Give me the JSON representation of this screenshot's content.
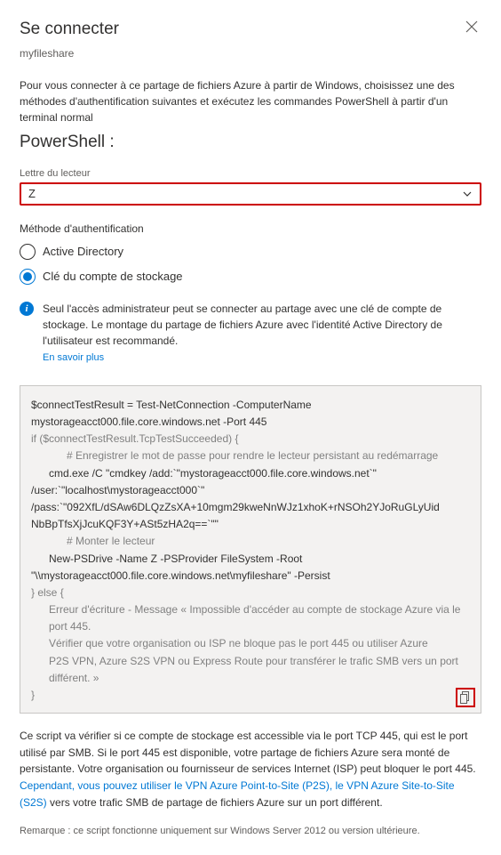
{
  "header": {
    "title": "Se connecter",
    "subtitle": "myfileshare"
  },
  "intro": "Pour vous connecter à ce partage de fichiers Azure à partir de Windows, choisissez une des méthodes d'authentification suivantes et exécutez les commandes PowerShell à partir d'un terminal normal",
  "section_title": "PowerShell :",
  "drive": {
    "label": "Lettre du lecteur",
    "value": "Z"
  },
  "auth": {
    "label": "Méthode d'authentification",
    "options": {
      "ad": "Active Directory",
      "key": "Clé du compte de stockage"
    }
  },
  "info": {
    "line1": "Seul l'accès administrateur peut se connecter au partage avec une clé de compte de stockage.",
    "line2": "Le montage du partage de fichiers Azure avec l'identité Active Directory de l'utilisateur est recommandé.",
    "learn_more": "En savoir plus"
  },
  "code": {
    "l1": "$connectTestResult = Test-NetConnection -ComputerName",
    "l2": "mystorageacct000.file.core.windows.net -Port 445",
    "l3": "if ($connectTestResult.TcpTestSucceeded) {",
    "c1": "# Enregistrer le mot de passe pour rendre le lecteur persistant au redémarrage",
    "l4": "cmd.exe /C \"cmdkey /add:`\"mystorageacct000.file.core.windows.net`\"",
    "l5": "/user:`\"localhost\\mystorageacct000`\"",
    "l6": "/pass:`\"092XfL/dSAw6DLQzZsXA+10mgm29kweNnWJz1xhoK+rNSOh2YJoRuGLyUid",
    "l7": "NbBpTfsXjJcuKQF3Y+ASt5zHA2q==`\"\"",
    "c2": "# Monter le lecteur",
    "l8": "New-PSDrive -Name Z -PSProvider FileSystem -Root",
    "l9": "\"\\\\mystorageacct000.file.core.windows.net\\myfileshare\" -Persist",
    "l10": "} else {",
    "l11": "Erreur d'écriture - Message « Impossible d'accéder au compte de stockage Azure via le port 445.",
    "l12": "Vérifier que votre organisation ou ISP ne bloque pas le port 445 ou utiliser Azure",
    "l13": "P2S VPN, Azure S2S VPN ou Express Route pour transférer le trafic SMB vers un port",
    "l14": "différent. »",
    "l15": "}"
  },
  "explain": {
    "text_before": "Ce script va vérifier si ce compte de stockage est accessible via le port TCP 445, qui est le port utilisé par SMB. Si le port 445 est disponible, votre partage de fichiers Azure sera monté de persistante. Votre organisation ou fournisseur de services Internet (ISP) peut bloquer le port 445. ",
    "link": "Cependant, vous pouvez utiliser le VPN Azure Point-to-Site (P2S), le VPN Azure Site-to-Site (S2S)",
    "text_after": " vers votre trafic SMB de partage de fichiers Azure sur un port différent."
  },
  "note": "Remarque : ce script fonctionne uniquement sur Windows Server 2012 ou version ultérieure."
}
